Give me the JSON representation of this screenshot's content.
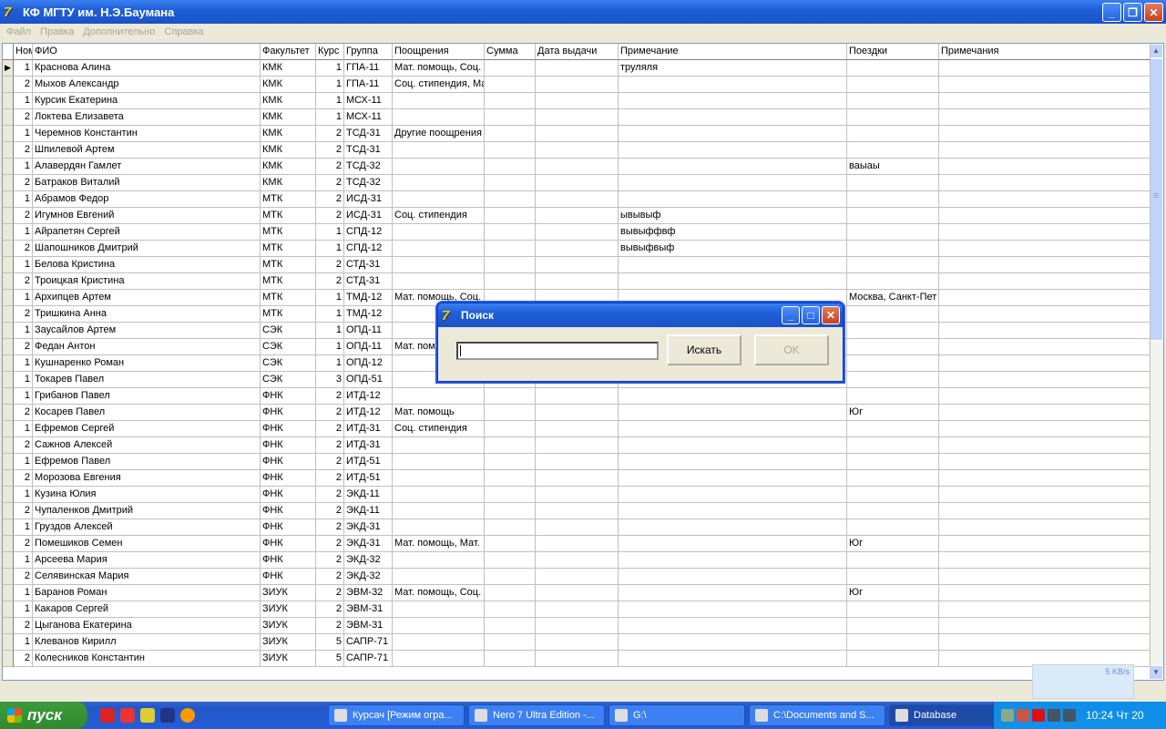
{
  "window": {
    "title": "КФ МГТУ им. Н.Э.Баумана"
  },
  "menu": [
    "Файл",
    "Правка",
    "Дополнительно",
    "Справка"
  ],
  "columns": [
    "Ном",
    "ФИО",
    "Факультет",
    "Курс",
    "Группа",
    "Поощрения",
    "Сумма",
    "Дата выдачи",
    "Примечание",
    "Поездки",
    "Примечания"
  ],
  "rows": [
    [
      "1",
      "Краснова Алина",
      "КМК",
      "1",
      "ГПА-11",
      "Мат. помощь, Соц.",
      "",
      "",
      "труляля",
      "",
      ""
    ],
    [
      "2",
      "Мыхов Александр",
      "КМК",
      "1",
      "ГПА-11",
      "Соц. стипендия, Ма",
      "",
      "",
      "",
      "",
      ""
    ],
    [
      "1",
      "Курсик Екатерина",
      "КМК",
      "1",
      "МСХ-11",
      "",
      "",
      "",
      "",
      "",
      ""
    ],
    [
      "2",
      "Локтева Елизавета",
      "КМК",
      "1",
      "МСХ-11",
      "",
      "",
      "",
      "",
      "",
      ""
    ],
    [
      "1",
      "Черемнов Константин",
      "КМК",
      "2",
      "ТСД-31",
      "Другие поощрения",
      "",
      "",
      "",
      "",
      ""
    ],
    [
      "2",
      "Шпилевой Артем",
      "КМК",
      "2",
      "ТСД-31",
      "",
      "",
      "",
      "",
      "",
      ""
    ],
    [
      "1",
      "Алавердян Гамлет",
      "КМК",
      "2",
      "ТСД-32",
      "",
      "",
      "",
      "",
      "ваыаы",
      ""
    ],
    [
      "2",
      "Батраков Виталий",
      "КМК",
      "2",
      "ТСД-32",
      "",
      "",
      "",
      "",
      "",
      ""
    ],
    [
      "1",
      "Абрамов Федор",
      "МТК",
      "2",
      "ИСД-31",
      "",
      "",
      "",
      "",
      "",
      ""
    ],
    [
      "2",
      "Игумнов Евгений",
      "МТК",
      "2",
      "ИСД-31",
      "Соц. стипендия",
      "",
      "",
      "ывывыф",
      "",
      ""
    ],
    [
      "1",
      "Айрапетян Сергей",
      "МТК",
      "1",
      "СПД-12",
      "",
      "",
      "",
      "вывыффвф",
      "",
      ""
    ],
    [
      "2",
      "Шапошников Дмитрий",
      "МТК",
      "1",
      "СПД-12",
      "",
      "",
      "",
      "вывыфвыф",
      "",
      ""
    ],
    [
      "1",
      "Белова Кристина",
      "МТК",
      "2",
      "СТД-31",
      "",
      "",
      "",
      "",
      "",
      ""
    ],
    [
      "2",
      "Троицкая Кристина",
      "МТК",
      "2",
      "СТД-31",
      "",
      "",
      "",
      "",
      "",
      ""
    ],
    [
      "1",
      "Архипцев Артем",
      "МТК",
      "1",
      "ТМД-12",
      "Мат. помощь, Соц.",
      "",
      "",
      "",
      "Москва, Санкт-Пет",
      ""
    ],
    [
      "2",
      "Тришкина Анна",
      "МТК",
      "1",
      "ТМД-12",
      "",
      "",
      "",
      "",
      "",
      ""
    ],
    [
      "1",
      "Заусайлов Артем",
      "СЭК",
      "1",
      "ОПД-11",
      "",
      "",
      "",
      "",
      "",
      ""
    ],
    [
      "2",
      "Федан Антон",
      "СЭК",
      "1",
      "ОПД-11",
      "Мат. помощь",
      "",
      "",
      "",
      "",
      ""
    ],
    [
      "1",
      "Кушнаренко Роман",
      "СЭК",
      "1",
      "ОПД-12",
      "",
      "",
      "",
      "",
      "",
      ""
    ],
    [
      "1",
      "Токарев Павел",
      "СЭК",
      "3",
      "ОПД-51",
      "",
      "",
      "",
      "",
      "",
      ""
    ],
    [
      "1",
      "Грибанов Павел",
      "ФНК",
      "2",
      "ИТД-12",
      "",
      "",
      "",
      "",
      "",
      ""
    ],
    [
      "2",
      "Косарев Павел",
      "ФНК",
      "2",
      "ИТД-12",
      "Мат. помощь",
      "",
      "",
      "",
      "Юг",
      ""
    ],
    [
      "1",
      "Ефремов Сергей",
      "ФНК",
      "2",
      "ИТД-31",
      "Соц. стипендия",
      "",
      "",
      "",
      "",
      ""
    ],
    [
      "2",
      "Сажнов Алексей",
      "ФНК",
      "2",
      "ИТД-31",
      "",
      "",
      "",
      "",
      "",
      ""
    ],
    [
      "1",
      "Ефремов Павел",
      "ФНК",
      "2",
      "ИТД-51",
      "",
      "",
      "",
      "",
      "",
      ""
    ],
    [
      "2",
      "Морозова Евгения",
      "ФНК",
      "2",
      "ИТД-51",
      "",
      "",
      "",
      "",
      "",
      ""
    ],
    [
      "1",
      "Кузина Юлия",
      "ФНК",
      "2",
      "ЭКД-11",
      "",
      "",
      "",
      "",
      "",
      ""
    ],
    [
      "2",
      "Чупаленков Дмитрий",
      "ФНК",
      "2",
      "ЭКД-11",
      "",
      "",
      "",
      "",
      "",
      ""
    ],
    [
      "1",
      "Груздов Алексей",
      "ФНК",
      "2",
      "ЭКД-31",
      "",
      "",
      "",
      "",
      "",
      ""
    ],
    [
      "2",
      "Помешиков Семен",
      "ФНК",
      "2",
      "ЭКД-31",
      "Мат. помощь, Мат.",
      "",
      "",
      "",
      "Юг",
      ""
    ],
    [
      "1",
      "Арсеева Мария",
      "ФНК",
      "2",
      "ЭКД-32",
      "",
      "",
      "",
      "",
      "",
      ""
    ],
    [
      "2",
      "Селявинская Мария",
      "ФНК",
      "2",
      "ЭКД-32",
      "",
      "",
      "",
      "",
      "",
      ""
    ],
    [
      "1",
      "Баранов Роман",
      "ЗИУК",
      "2",
      "ЭВМ-32",
      "Мат. помощь, Соц.",
      "",
      "",
      "",
      "Юг",
      ""
    ],
    [
      "1",
      "Какаров Сергей",
      "ЗИУК",
      "2",
      "ЭВМ-31",
      "",
      "",
      "",
      "",
      "",
      ""
    ],
    [
      "2",
      "Цыганова Екатерина",
      "ЗИУК",
      "2",
      "ЭВМ-31",
      "",
      "",
      "",
      "",
      "",
      ""
    ],
    [
      "1",
      "Клеванов Кирилл",
      "ЗИУК",
      "5",
      "САПР-71",
      "",
      "",
      "",
      "",
      "",
      ""
    ],
    [
      "2",
      "Колесников Константин",
      "ЗИУК",
      "5",
      "САПР-71",
      "",
      "",
      "",
      "",
      "",
      ""
    ]
  ],
  "selected_row": 0,
  "dialog": {
    "title": "Поиск",
    "input_value": "",
    "search_label": "Искать",
    "ok_label": "OK"
  },
  "network_widget": {
    "speed": "5 KB/s"
  },
  "taskbar": {
    "start_label": "пуск",
    "tasks": [
      "Курсач [Режим огра...",
      "Nero 7 Ultra Edition -...",
      "G:\\",
      "C:\\Documents and S...",
      "Database"
    ],
    "active_task": 4,
    "clock": "10:24 Чт 20"
  }
}
